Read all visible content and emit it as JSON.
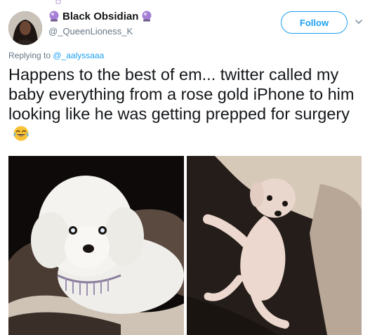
{
  "tweet": {
    "author": {
      "display_name": "Black Obsidian",
      "handle": "@_QueenLioness_K"
    },
    "follow_label": "Follow",
    "replying_prefix": "Replying to",
    "replying_handle": "@_aalyssaaa",
    "text": "Happens to the best of em... twitter called my baby everything from a rose gold iPhone to him looking like he was getting prepped for surgery",
    "emoji": "tears-of-joy-icon"
  },
  "colors": {
    "accent": "#1da1f2",
    "text": "#14171a",
    "secondary_text": "#657786"
  },
  "icons": {
    "name_prefix": "crystal-ball-icon",
    "name_suffix": "crystal-ball-icon",
    "menu": "chevron-down-icon"
  },
  "media": {
    "count": 2
  }
}
